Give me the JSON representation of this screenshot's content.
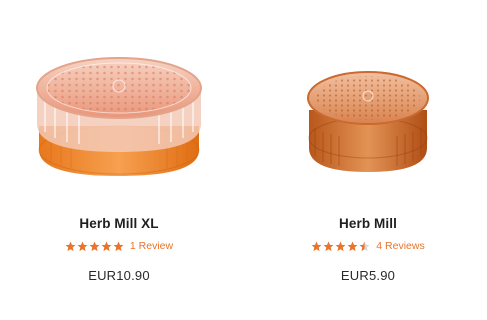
{
  "products": [
    {
      "name": "Herb Mill XL",
      "rating": 5,
      "reviews_label": "1 Review",
      "price": "EUR10.90",
      "image_alt": "product-image"
    },
    {
      "name": "Herb Mill",
      "rating": 4.5,
      "reviews_label": "4 Reviews",
      "price": "EUR5.90",
      "image_alt": "product-image"
    }
  ],
  "colors": {
    "accent": "#e9742b",
    "text": "#1f1f1f"
  }
}
